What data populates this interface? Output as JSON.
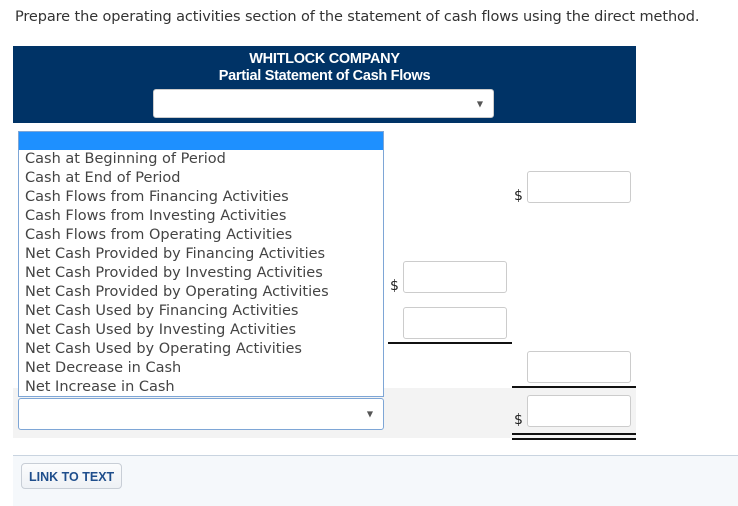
{
  "instruction": "Prepare the operating activities section of the statement of cash flows using the direct method.",
  "header": {
    "company": "WHITLOCK COMPANY",
    "subtitle": "Partial Statement of Cash Flows",
    "period_select_value": ""
  },
  "dropdown": {
    "selected": "",
    "options": [
      "",
      "Cash at Beginning of Period",
      "Cash at End of Period",
      "Cash Flows from Financing Activities",
      "Cash Flows from Investing Activities",
      "Cash Flows from Operating Activities",
      "Net Cash Provided by Financing Activities",
      "Net Cash Provided by Investing Activities",
      "Net Cash Provided by Operating Activities",
      "Net Cash Used by Financing Activities",
      "Net Cash Used by Investing Activities",
      "Net Cash Used by Operating Activities",
      "Net Decrease in Cash",
      "Net Increase in Cash"
    ]
  },
  "row_select_value": "",
  "currency_symbol": "$",
  "amounts": {
    "row1_total": "",
    "row2_item": "",
    "row3_item": "",
    "row4_total": "",
    "row5_total": ""
  },
  "footer": {
    "link_label": "LINK TO TEXT"
  },
  "colors": {
    "header_bg": "#003366",
    "selected_option": "#1e90ff",
    "link_text": "#1f4e8c"
  }
}
